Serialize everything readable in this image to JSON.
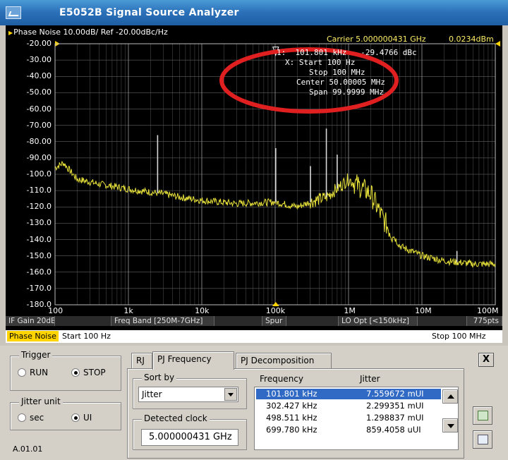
{
  "window": {
    "title": "E5052B Signal Source Analyzer"
  },
  "graph": {
    "header": "Phase Noise 10.00dB/ Ref -20.00dBc/Hz",
    "carrier": "Carrier 5.000000431 GHz",
    "carrier_level": "0.0234dBm",
    "marker": {
      "line1": "1:  101.801 kHz   -29.4766 dBc",
      "x_line": "X: Start 100 Hz",
      "stop_line": "Stop 100 MHz",
      "center_line": "Center 50.00005 MHz",
      "span_line": "Span 99.9999 MHz"
    },
    "y_ticks": [
      "-20.00",
      "-30.00",
      "-40.00",
      "-50.00",
      "-60.00",
      "-70.00",
      "-80.00",
      "-90.00",
      "-100.0",
      "-110.0",
      "-120.0",
      "-130.0",
      "-140.0",
      "-150.0",
      "-160.0",
      "-170.0",
      "-180.0"
    ],
    "x_ticks": [
      "100",
      "1k",
      "10k",
      "100k",
      "1M",
      "10M",
      "100M"
    ],
    "trace_color": "#e8e23a",
    "highlight_color": "#e02020",
    "status": [
      "IF Gain 20dB",
      "Freq Band [250M-7GHz]",
      "Spur",
      "LO Opt [<150kHz]",
      "775pts"
    ],
    "stim_tag": "Phase Noise",
    "start": "Start 100 Hz",
    "stop": "Stop 100 MHz"
  },
  "chart_data": {
    "type": "line",
    "title": "Phase Noise 10.00dB/ Ref -20.00dBc/Hz",
    "x_scale": "log",
    "xlim": [
      100,
      100000000
    ],
    "ylim": [
      -180,
      -20
    ],
    "x_tick_labels": [
      "100",
      "1k",
      "10k",
      "100k",
      "1M",
      "10M",
      "100M"
    ],
    "series": [
      {
        "x": [
          100,
          130,
          200,
          400,
          1000,
          2000,
          3000,
          5000,
          10000,
          30000,
          100000,
          200000,
          300000,
          500000,
          1000000,
          2000000,
          3000000,
          5000000,
          10000000,
          20000000,
          50000000,
          100000000
        ],
        "y": [
          -96,
          -93,
          -103,
          -106,
          -109,
          -111,
          -112,
          -114,
          -116,
          -118,
          -117,
          -120,
          -117,
          -114,
          -103,
          -112,
          -128,
          -144,
          -150,
          -153,
          -155,
          -155
        ]
      }
    ],
    "spurs": [
      {
        "x": 2500,
        "y": -76
      },
      {
        "x": 101801,
        "y": -84
      },
      {
        "x": 302427,
        "y": -95
      },
      {
        "x": 498511,
        "y": -72
      },
      {
        "x": 699780,
        "y": -88
      },
      {
        "x": 30000000,
        "y": -147
      }
    ],
    "grid": true
  },
  "panel": {
    "trigger_label": "Trigger",
    "run_label": "RUN",
    "stop_label": "STOP",
    "jitter_unit_label": "Jitter unit",
    "sec_label": "sec",
    "ui_label": "UI",
    "version": "A.01.01",
    "tabs": [
      "RJ",
      "PJ Frequency",
      "PJ Decomposition"
    ],
    "close": "X",
    "sort_by_label": "Sort by",
    "sort_value": "Jitter",
    "detected_clock_label": "Detected clock",
    "detected_clock_value": "5.000000431 GHz",
    "col_frequency": "Frequency",
    "col_jitter": "Jitter",
    "rows": [
      {
        "freq": "101.801 kHz",
        "jitter": "7.559672 mUI"
      },
      {
        "freq": "302.427 kHz",
        "jitter": "2.299351 mUI"
      },
      {
        "freq": "498.511 kHz",
        "jitter": "1.298837 mUI"
      },
      {
        "freq": "699.780 kHz",
        "jitter": "859.4058 uUI"
      }
    ]
  }
}
